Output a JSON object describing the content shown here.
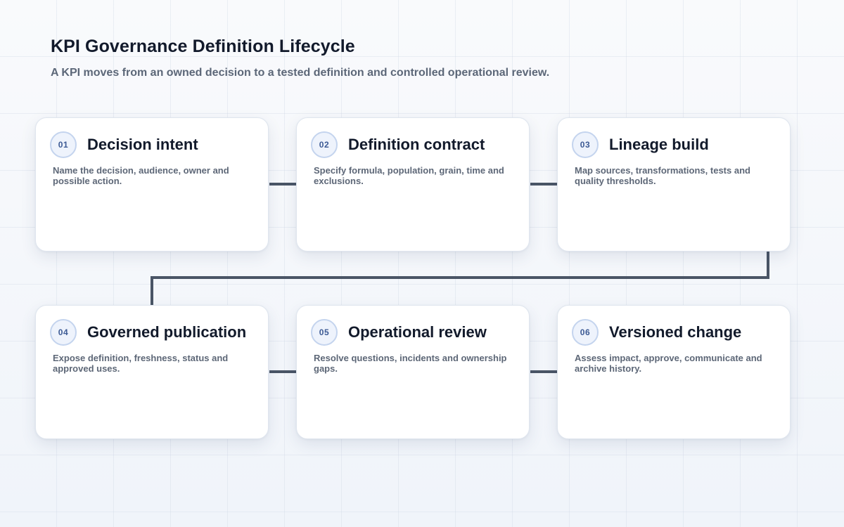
{
  "header": {
    "title": "KPI Governance Definition Lifecycle",
    "subtitle": "A KPI moves from an owned decision to a tested definition and controlled operational review."
  },
  "colors": {
    "connector": "#4a5566",
    "badge_text": "#3c5a94",
    "card_background": "#ffffff"
  },
  "steps": [
    {
      "number": "01",
      "title": "Decision intent",
      "description": "Name the decision, audience, owner and possible action."
    },
    {
      "number": "02",
      "title": "Definition contract",
      "description": "Specify formula, population, grain, time and exclusions."
    },
    {
      "number": "03",
      "title": "Lineage build",
      "description": "Map sources, transformations, tests and quality thresholds."
    },
    {
      "number": "04",
      "title": "Governed publication",
      "description": "Expose definition, freshness, status and approved uses."
    },
    {
      "number": "05",
      "title": "Operational review",
      "description": "Resolve questions, incidents and ownership gaps."
    },
    {
      "number": "06",
      "title": "Versioned change",
      "description": "Assess impact, approve, communicate and archive history."
    }
  ]
}
